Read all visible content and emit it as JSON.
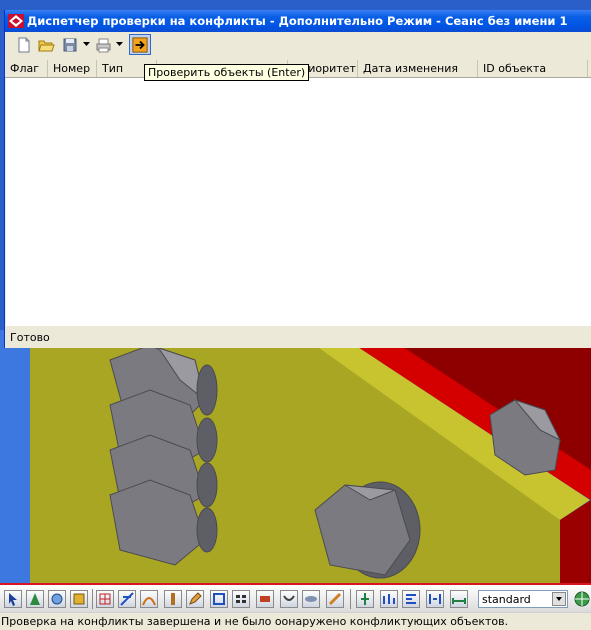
{
  "window": {
    "title": "Диспетчер проверки на конфликты - Дополнительно Режим - Сеанс без имени 1",
    "icon": "app-diamond-icon"
  },
  "toolbar": {
    "buttons": [
      {
        "name": "new-file-icon"
      },
      {
        "name": "open-folder-icon"
      },
      {
        "name": "save-icon"
      },
      {
        "name": "print-icon"
      },
      {
        "name": "check-objects-icon"
      }
    ],
    "tooltip": "Проверить объекты (Enter)"
  },
  "list": {
    "columns": [
      "Флаг",
      "Номер",
      "Тип",
      "",
      "Приоритет",
      "Дата изменения",
      "ID объекта"
    ],
    "rows": []
  },
  "dialog_status": "Готово",
  "bottom_toolbar": {
    "style_select": {
      "value": "standard"
    },
    "icons": [
      "select-arrow-icon",
      "cone-icon",
      "hole-icon",
      "plate-icon",
      "grid-icon",
      "line-icon",
      "curve-icon",
      "bolt-icon",
      "edit-icon",
      "frame-icon",
      "array-icon",
      "part-icon",
      "weld-icon",
      "pipe-icon",
      "tool-icon",
      "snap-icon",
      "level-icon",
      "align-icon",
      "distribute-icon",
      "dimension-icon"
    ],
    "globe": "globe-icon"
  },
  "app_status": "Проверка на конфликты завершена и не было оонаружено конфликтующих объектов.",
  "colors": {
    "title_bar": "#0055e5",
    "model_yellow": "#b7b52c",
    "model_red": "#d40000",
    "viewport_blue": "#2a5ec8",
    "bolt_gray": "#7a7a80"
  }
}
